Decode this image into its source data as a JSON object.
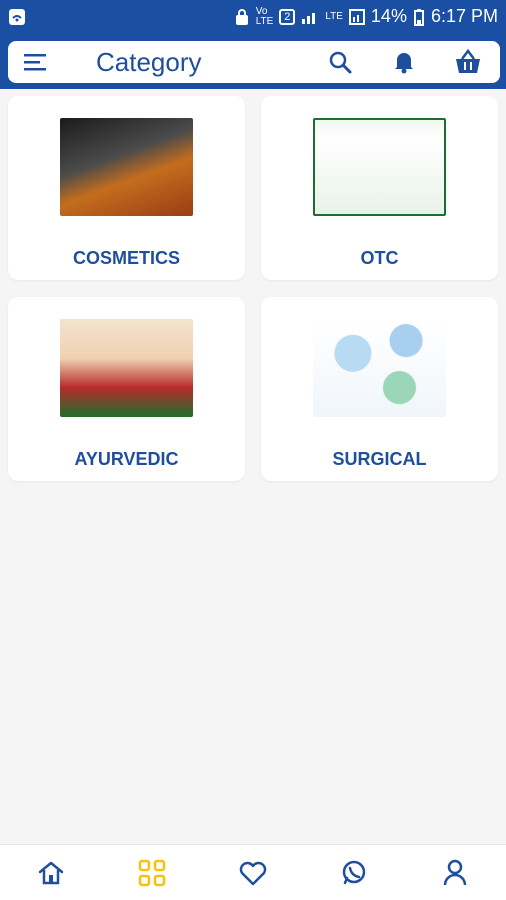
{
  "status_bar": {
    "left_icon": "wifi-icon",
    "network": "Vo",
    "network_sub": "LTE",
    "sim": "2",
    "signal": "LTE",
    "battery": "14%",
    "time": "6:17 PM"
  },
  "appbar": {
    "title": "Category"
  },
  "categories": [
    {
      "label": "COSMETICS"
    },
    {
      "label": "OTC"
    },
    {
      "label": "AYURVEDIC"
    },
    {
      "label": "SURGICAL"
    }
  ],
  "bottom_nav": {
    "items": [
      "home-icon",
      "grid-icon",
      "heart-icon",
      "whatsapp-icon",
      "user-icon"
    ],
    "active": "grid-icon"
  },
  "colors": {
    "brand_blue": "#1a4fa3",
    "active_yellow": "#f6c20d",
    "text_blue": "#1f4f9c"
  }
}
